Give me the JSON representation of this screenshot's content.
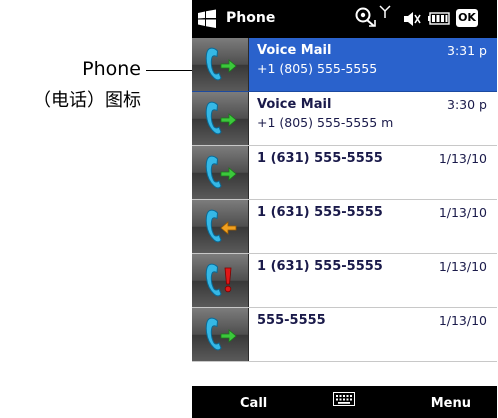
{
  "annotation": {
    "label_line1": "Phone",
    "label_line2": "（电话）图标"
  },
  "titlebar": {
    "title": "Phone",
    "ok_label": "ok"
  },
  "calls": [
    {
      "name": "Voice Mail",
      "number": "+1 (805) 555-5555",
      "time": "3:31 p",
      "type": "outgoing",
      "selected": true
    },
    {
      "name": "Voice Mail",
      "number": "+1 (805) 555-5555 m",
      "time": "3:30 p",
      "type": "outgoing",
      "selected": false
    },
    {
      "name": "1 (631) 555-5555",
      "number": "",
      "time": "1/13/10",
      "type": "outgoing",
      "selected": false
    },
    {
      "name": "1 (631) 555-5555",
      "number": "",
      "time": "1/13/10",
      "type": "incoming",
      "selected": false
    },
    {
      "name": "1 (631) 555-5555",
      "number": "",
      "time": "1/13/10",
      "type": "missed",
      "selected": false
    },
    {
      "name": "555-5555",
      "number": "",
      "time": "1/13/10",
      "type": "outgoing",
      "selected": false
    }
  ],
  "softkeys": {
    "left": "Call",
    "right": "Menu"
  },
  "colors": {
    "selection": "#2a62cc",
    "arrow_outgoing": "#3cc83c",
    "arrow_incoming": "#f0a020",
    "missed_mark": "#e01818",
    "handset": "#35b8e6"
  }
}
